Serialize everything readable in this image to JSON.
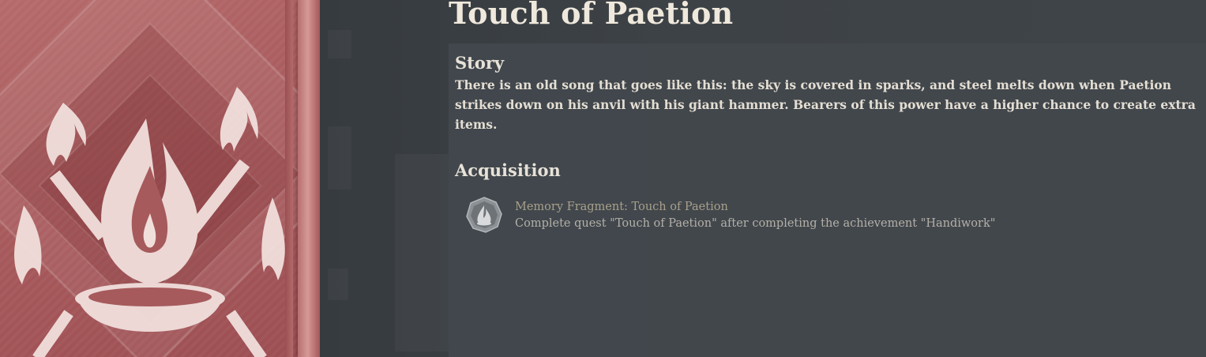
{
  "title": "Touch of Paetion",
  "story": {
    "heading": "Story",
    "text": "There is an old song that goes like this: the sky is covered in sparks, and steel melts down when Paetion strikes down on his anvil with his giant hammer. Bearers of this power have a higher chance to create extra items."
  },
  "acquisition": {
    "heading": "Acquisition",
    "item_name": "Memory Fragment: Touch of Paetion",
    "item_desc": "Complete quest \"Touch of Paetion\" after completing the achievement \"Handiwork\"",
    "icon": "flame-fragment-icon"
  },
  "colors": {
    "card": "#a85a5c",
    "panel": "#42484d",
    "title": "#efe8dc",
    "acq_name": "#a8a08c"
  }
}
